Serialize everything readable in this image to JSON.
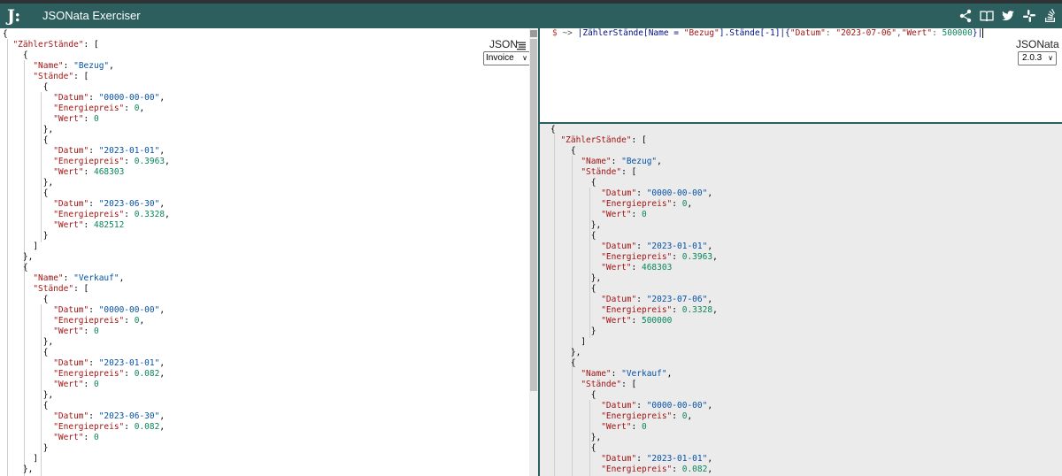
{
  "app": {
    "logo": "J:",
    "title": "JSONata Exerciser"
  },
  "header_icons": [
    "share-icon",
    "book-icon",
    "twitter-icon",
    "slack-icon",
    "stackoverflow-icon"
  ],
  "input_panel": {
    "format_label": "JSON",
    "sample_selected": "Invoice",
    "lines": [
      [
        [
          "p",
          "{"
        ]
      ],
      [
        [
          "p",
          "  "
        ],
        [
          "k",
          "\"ZählerStände\""
        ],
        [
          "p",
          ": ["
        ]
      ],
      [
        [
          "p",
          "    {"
        ]
      ],
      [
        [
          "p",
          "      "
        ],
        [
          "k",
          "\"Name\""
        ],
        [
          "p",
          ": "
        ],
        [
          "s",
          "\"Bezug\""
        ],
        [
          "p",
          ","
        ]
      ],
      [
        [
          "p",
          "      "
        ],
        [
          "k",
          "\"Stände\""
        ],
        [
          "p",
          ": ["
        ]
      ],
      [
        [
          "p",
          "        {"
        ]
      ],
      [
        [
          "p",
          "          "
        ],
        [
          "k",
          "\"Datum\""
        ],
        [
          "p",
          ": "
        ],
        [
          "s",
          "\"0000-00-00\""
        ],
        [
          "p",
          ","
        ]
      ],
      [
        [
          "p",
          "          "
        ],
        [
          "k",
          "\"Energiepreis\""
        ],
        [
          "p",
          ": "
        ],
        [
          "n",
          "0"
        ],
        [
          "p",
          ","
        ]
      ],
      [
        [
          "p",
          "          "
        ],
        [
          "k",
          "\"Wert\""
        ],
        [
          "p",
          ": "
        ],
        [
          "n",
          "0"
        ]
      ],
      [
        [
          "p",
          "        },"
        ]
      ],
      [
        [
          "p",
          "        {"
        ]
      ],
      [
        [
          "p",
          "          "
        ],
        [
          "k",
          "\"Datum\""
        ],
        [
          "p",
          ": "
        ],
        [
          "s",
          "\"2023-01-01\""
        ],
        [
          "p",
          ","
        ]
      ],
      [
        [
          "p",
          "          "
        ],
        [
          "k",
          "\"Energiepreis\""
        ],
        [
          "p",
          ": "
        ],
        [
          "n",
          "0.3963"
        ],
        [
          "p",
          ","
        ]
      ],
      [
        [
          "p",
          "          "
        ],
        [
          "k",
          "\"Wert\""
        ],
        [
          "p",
          ": "
        ],
        [
          "n",
          "468303"
        ]
      ],
      [
        [
          "p",
          "        },"
        ]
      ],
      [
        [
          "p",
          "        {"
        ]
      ],
      [
        [
          "p",
          "          "
        ],
        [
          "k",
          "\"Datum\""
        ],
        [
          "p",
          ": "
        ],
        [
          "s",
          "\"2023-06-30\""
        ],
        [
          "p",
          ","
        ]
      ],
      [
        [
          "p",
          "          "
        ],
        [
          "k",
          "\"Energiepreis\""
        ],
        [
          "p",
          ": "
        ],
        [
          "n",
          "0.3328"
        ],
        [
          "p",
          ","
        ]
      ],
      [
        [
          "p",
          "          "
        ],
        [
          "k",
          "\"Wert\""
        ],
        [
          "p",
          ": "
        ],
        [
          "n",
          "482512"
        ]
      ],
      [
        [
          "p",
          "        }"
        ]
      ],
      [
        [
          "p",
          "      ]"
        ]
      ],
      [
        [
          "p",
          "    },"
        ]
      ],
      [
        [
          "p",
          "    {"
        ]
      ],
      [
        [
          "p",
          "      "
        ],
        [
          "k",
          "\"Name\""
        ],
        [
          "p",
          ": "
        ],
        [
          "s",
          "\"Verkauf\""
        ],
        [
          "p",
          ","
        ]
      ],
      [
        [
          "p",
          "      "
        ],
        [
          "k",
          "\"Stände\""
        ],
        [
          "p",
          ": ["
        ]
      ],
      [
        [
          "p",
          "        {"
        ]
      ],
      [
        [
          "p",
          "          "
        ],
        [
          "k",
          "\"Datum\""
        ],
        [
          "p",
          ": "
        ],
        [
          "s",
          "\"0000-00-00\""
        ],
        [
          "p",
          ","
        ]
      ],
      [
        [
          "p",
          "          "
        ],
        [
          "k",
          "\"Energiepreis\""
        ],
        [
          "p",
          ": "
        ],
        [
          "n",
          "0"
        ],
        [
          "p",
          ","
        ]
      ],
      [
        [
          "p",
          "          "
        ],
        [
          "k",
          "\"Wert\""
        ],
        [
          "p",
          ": "
        ],
        [
          "n",
          "0"
        ]
      ],
      [
        [
          "p",
          "        },"
        ]
      ],
      [
        [
          "p",
          "        {"
        ]
      ],
      [
        [
          "p",
          "          "
        ],
        [
          "k",
          "\"Datum\""
        ],
        [
          "p",
          ": "
        ],
        [
          "s",
          "\"2023-01-01\""
        ],
        [
          "p",
          ","
        ]
      ],
      [
        [
          "p",
          "          "
        ],
        [
          "k",
          "\"Energiepreis\""
        ],
        [
          "p",
          ": "
        ],
        [
          "n",
          "0.082"
        ],
        [
          "p",
          ","
        ]
      ],
      [
        [
          "p",
          "          "
        ],
        [
          "k",
          "\"Wert\""
        ],
        [
          "p",
          ": "
        ],
        [
          "n",
          "0"
        ]
      ],
      [
        [
          "p",
          "        },"
        ]
      ],
      [
        [
          "p",
          "        {"
        ]
      ],
      [
        [
          "p",
          "          "
        ],
        [
          "k",
          "\"Datum\""
        ],
        [
          "p",
          ": "
        ],
        [
          "s",
          "\"2023-06-30\""
        ],
        [
          "p",
          ","
        ]
      ],
      [
        [
          "p",
          "          "
        ],
        [
          "k",
          "\"Energiepreis\""
        ],
        [
          "p",
          ": "
        ],
        [
          "n",
          "0.082"
        ],
        [
          "p",
          ","
        ]
      ],
      [
        [
          "p",
          "          "
        ],
        [
          "k",
          "\"Wert\""
        ],
        [
          "p",
          ": "
        ],
        [
          "n",
          "0"
        ]
      ],
      [
        [
          "p",
          "        }"
        ]
      ],
      [
        [
          "p",
          "      ]"
        ]
      ],
      [
        [
          "p",
          "    },"
        ]
      ]
    ]
  },
  "expression": {
    "tokens": [
      [
        "dollar",
        "$"
      ],
      [
        "op",
        " ~> "
      ],
      [
        "ex-field",
        "|ZählerStände[Name = "
      ],
      [
        "ex-str",
        "\"Bezug\""
      ],
      [
        "ex-field",
        "].Stände[-1]|{"
      ],
      [
        "ex-str",
        "\"Datum\""
      ],
      [
        "op",
        ": "
      ],
      [
        "ex-str",
        "\"2023-07-06\""
      ],
      [
        "op",
        ","
      ],
      [
        "ex-str",
        "\"Wert\""
      ],
      [
        "op",
        ": "
      ],
      [
        "ex-num",
        "500000"
      ],
      [
        "ex-field",
        "}|"
      ]
    ]
  },
  "version_panel": {
    "label": "JSONata",
    "version_selected": "2.0.3"
  },
  "result_panel": {
    "lines": [
      [
        [
          "p",
          "{"
        ]
      ],
      [
        [
          "p",
          "  "
        ],
        [
          "k",
          "\"ZählerStände\""
        ],
        [
          "p",
          ": ["
        ]
      ],
      [
        [
          "p",
          "    {"
        ]
      ],
      [
        [
          "p",
          "      "
        ],
        [
          "k",
          "\"Name\""
        ],
        [
          "p",
          ": "
        ],
        [
          "s",
          "\"Bezug\""
        ],
        [
          "p",
          ","
        ]
      ],
      [
        [
          "p",
          "      "
        ],
        [
          "k",
          "\"Stände\""
        ],
        [
          "p",
          ": ["
        ]
      ],
      [
        [
          "p",
          "        {"
        ]
      ],
      [
        [
          "p",
          "          "
        ],
        [
          "k",
          "\"Datum\""
        ],
        [
          "p",
          ": "
        ],
        [
          "s",
          "\"0000-00-00\""
        ],
        [
          "p",
          ","
        ]
      ],
      [
        [
          "p",
          "          "
        ],
        [
          "k",
          "\"Energiepreis\""
        ],
        [
          "p",
          ": "
        ],
        [
          "n",
          "0"
        ],
        [
          "p",
          ","
        ]
      ],
      [
        [
          "p",
          "          "
        ],
        [
          "k",
          "\"Wert\""
        ],
        [
          "p",
          ": "
        ],
        [
          "n",
          "0"
        ]
      ],
      [
        [
          "p",
          "        },"
        ]
      ],
      [
        [
          "p",
          "        {"
        ]
      ],
      [
        [
          "p",
          "          "
        ],
        [
          "k",
          "\"Datum\""
        ],
        [
          "p",
          ": "
        ],
        [
          "s",
          "\"2023-01-01\""
        ],
        [
          "p",
          ","
        ]
      ],
      [
        [
          "p",
          "          "
        ],
        [
          "k",
          "\"Energiepreis\""
        ],
        [
          "p",
          ": "
        ],
        [
          "n",
          "0.3963"
        ],
        [
          "p",
          ","
        ]
      ],
      [
        [
          "p",
          "          "
        ],
        [
          "k",
          "\"Wert\""
        ],
        [
          "p",
          ": "
        ],
        [
          "n",
          "468303"
        ]
      ],
      [
        [
          "p",
          "        },"
        ]
      ],
      [
        [
          "p",
          "        {"
        ]
      ],
      [
        [
          "p",
          "          "
        ],
        [
          "k",
          "\"Datum\""
        ],
        [
          "p",
          ": "
        ],
        [
          "s",
          "\"2023-07-06\""
        ],
        [
          "p",
          ","
        ]
      ],
      [
        [
          "p",
          "          "
        ],
        [
          "k",
          "\"Energiepreis\""
        ],
        [
          "p",
          ": "
        ],
        [
          "n",
          "0.3328"
        ],
        [
          "p",
          ","
        ]
      ],
      [
        [
          "p",
          "          "
        ],
        [
          "k",
          "\"Wert\""
        ],
        [
          "p",
          ": "
        ],
        [
          "n",
          "500000"
        ]
      ],
      [
        [
          "p",
          "        }"
        ]
      ],
      [
        [
          "p",
          "      ]"
        ]
      ],
      [
        [
          "p",
          "    },"
        ]
      ],
      [
        [
          "p",
          "    {"
        ]
      ],
      [
        [
          "p",
          "      "
        ],
        [
          "k",
          "\"Name\""
        ],
        [
          "p",
          ": "
        ],
        [
          "s",
          "\"Verkauf\""
        ],
        [
          "p",
          ","
        ]
      ],
      [
        [
          "p",
          "      "
        ],
        [
          "k",
          "\"Stände\""
        ],
        [
          "p",
          ": ["
        ]
      ],
      [
        [
          "p",
          "        {"
        ]
      ],
      [
        [
          "p",
          "          "
        ],
        [
          "k",
          "\"Datum\""
        ],
        [
          "p",
          ": "
        ],
        [
          "s",
          "\"0000-00-00\""
        ],
        [
          "p",
          ","
        ]
      ],
      [
        [
          "p",
          "          "
        ],
        [
          "k",
          "\"Energiepreis\""
        ],
        [
          "p",
          ": "
        ],
        [
          "n",
          "0"
        ],
        [
          "p",
          ","
        ]
      ],
      [
        [
          "p",
          "          "
        ],
        [
          "k",
          "\"Wert\""
        ],
        [
          "p",
          ": "
        ],
        [
          "n",
          "0"
        ]
      ],
      [
        [
          "p",
          "        },"
        ]
      ],
      [
        [
          "p",
          "        {"
        ]
      ],
      [
        [
          "p",
          "          "
        ],
        [
          "k",
          "\"Datum\""
        ],
        [
          "p",
          ": "
        ],
        [
          "s",
          "\"2023-01-01\""
        ],
        [
          "p",
          ","
        ]
      ],
      [
        [
          "p",
          "          "
        ],
        [
          "k",
          "\"Energiepreis\""
        ],
        [
          "p",
          ": "
        ],
        [
          "n",
          "0.082"
        ],
        [
          "p",
          ","
        ]
      ]
    ]
  },
  "colors": {
    "header_bg": "#2c5f5d",
    "result_bg": "#ebebeb",
    "json_key": "#a31515",
    "json_string": "#0451a5",
    "json_number": "#098658"
  }
}
